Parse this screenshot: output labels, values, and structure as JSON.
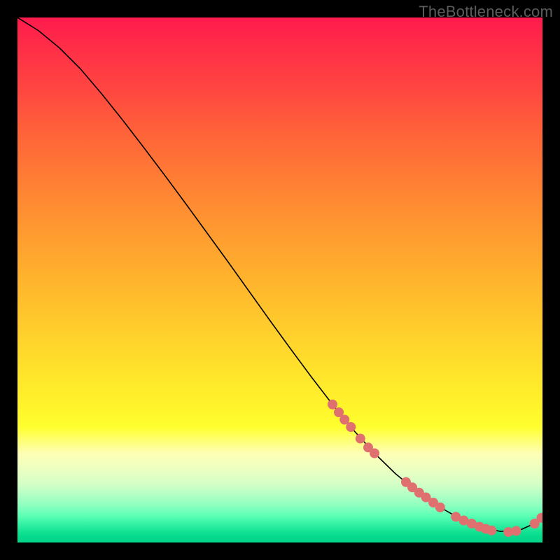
{
  "watermark": "TheBottleneck.com",
  "chart_data": {
    "type": "line",
    "title": "",
    "xlabel": "",
    "ylabel": "",
    "xlim": [
      0,
      100
    ],
    "ylim": [
      0,
      100
    ],
    "grid": false,
    "series": [
      {
        "name": "curve",
        "color": "#000000",
        "x": [
          0,
          4,
          8,
          12,
          16,
          20,
          24,
          28,
          32,
          36,
          40,
          44,
          48,
          52,
          56,
          60,
          64,
          68,
          72,
          76,
          80,
          84,
          88,
          92,
          96,
          98,
          100
        ],
        "y": [
          100,
          97.5,
          94.2,
          90.2,
          85.5,
          80.5,
          75.3,
          70.0,
          64.6,
          59.1,
          53.6,
          48.0,
          42.4,
          36.9,
          31.5,
          26.3,
          21.4,
          17.0,
          13.1,
          9.8,
          7.0,
          4.7,
          3.0,
          2.1,
          2.5,
          3.4,
          4.8
        ]
      }
    ],
    "markers": {
      "color": "#e07070",
      "radius_px": 7,
      "points": [
        {
          "x": 60.0,
          "y": 26.3
        },
        {
          "x": 61.2,
          "y": 24.8
        },
        {
          "x": 62.3,
          "y": 23.4
        },
        {
          "x": 63.5,
          "y": 22.0
        },
        {
          "x": 65.3,
          "y": 19.8
        },
        {
          "x": 66.8,
          "y": 18.1
        },
        {
          "x": 68.0,
          "y": 17.0
        },
        {
          "x": 74.0,
          "y": 11.5
        },
        {
          "x": 75.2,
          "y": 10.5
        },
        {
          "x": 76.5,
          "y": 9.5
        },
        {
          "x": 77.8,
          "y": 8.6
        },
        {
          "x": 79.2,
          "y": 7.6
        },
        {
          "x": 80.5,
          "y": 6.7
        },
        {
          "x": 83.5,
          "y": 4.9
        },
        {
          "x": 85.0,
          "y": 4.2
        },
        {
          "x": 86.5,
          "y": 3.6
        },
        {
          "x": 88.0,
          "y": 3.0
        },
        {
          "x": 89.2,
          "y": 2.6
        },
        {
          "x": 90.3,
          "y": 2.3
        },
        {
          "x": 93.5,
          "y": 2.0
        },
        {
          "x": 95.0,
          "y": 2.2
        },
        {
          "x": 98.5,
          "y": 3.6
        },
        {
          "x": 99.8,
          "y": 4.7
        }
      ]
    }
  }
}
